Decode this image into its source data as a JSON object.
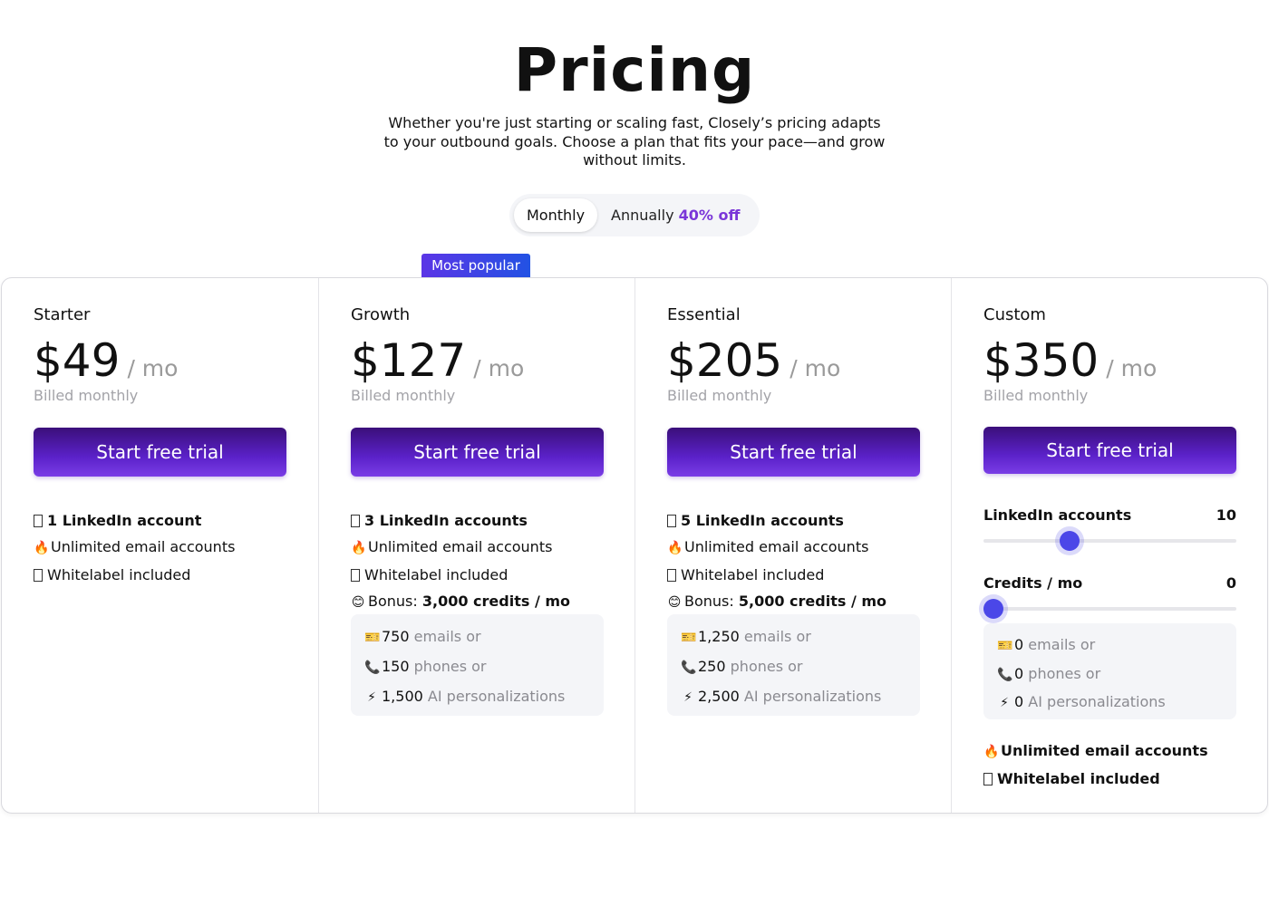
{
  "hero": {
    "title": "Pricing",
    "subtitle": "Whether you're just starting or scaling fast, Closely’s pricing adapts to your outbound goals. Choose a plan that fits your pace—and grow without limits."
  },
  "billing_toggle": {
    "monthly_label": "Monthly",
    "annual_label": "Annually",
    "annual_discount": "40% off",
    "selected": "Monthly"
  },
  "badge": {
    "label": "Most popular"
  },
  "plans": [
    {
      "name": "Starter",
      "price": "$49",
      "period": "/ mo",
      "billing": "Billed monthly",
      "cta": "Start free trial",
      "features": {
        "linkedin": "1 LinkedIn account",
        "email": "Unlimited email accounts",
        "whitelabel": "Whitelabel included"
      }
    },
    {
      "name": "Growth",
      "price": "$127",
      "period": "/ mo",
      "billing": "Billed monthly",
      "cta": "Start free trial",
      "features": {
        "linkedin": "3 LinkedIn accounts",
        "email": "Unlimited email accounts",
        "whitelabel": "Whitelabel included",
        "bonus_prefix": "Bonus:",
        "bonus_value": "3,000 credits / mo"
      },
      "credits": {
        "emails_value": "750",
        "emails_label": "emails or",
        "phones_value": "150",
        "phones_label": "phones or",
        "ai_value": "1,500",
        "ai_label": "AI personalizations"
      }
    },
    {
      "name": "Essential",
      "price": "$205",
      "period": "/ mo",
      "billing": "Billed monthly",
      "cta": "Start free trial",
      "features": {
        "linkedin": "5 LinkedIn accounts",
        "email": "Unlimited email accounts",
        "whitelabel": "Whitelabel included",
        "bonus_prefix": "Bonus:",
        "bonus_value": "5,000 credits / mo"
      },
      "credits": {
        "emails_value": "1,250",
        "emails_label": "emails or",
        "phones_value": "250",
        "phones_label": "phones or",
        "ai_value": "2,500",
        "ai_label": "AI personalizations"
      }
    },
    {
      "name": "Custom",
      "price": "$350",
      "period": "/ mo",
      "billing": "Billed monthly",
      "cta": "Start free trial",
      "sliders": {
        "linkedin_label": "LinkedIn accounts",
        "linkedin_value": "10",
        "linkedin_fraction": 0.34,
        "credits_label": "Credits / mo",
        "credits_value": "0",
        "credits_fraction": 0.0
      },
      "credits": {
        "emails_value": "0",
        "emails_label": "emails or",
        "phones_value": "0",
        "phones_label": "phones or",
        "ai_value": "0",
        "ai_label": "AI personalizations"
      },
      "features": {
        "email": "Unlimited email accounts",
        "whitelabel": "Whitelabel included"
      }
    }
  ],
  "icons": {
    "linkedin": "square-icon",
    "email": "fire-icon",
    "whitelabel": "square-icon",
    "bonus": "smile-icon",
    "emails": "ticket-icon",
    "phones": "phone-icon",
    "ai": "lightning-icon"
  },
  "colors": {
    "accent_purple": "#7a36d8",
    "cta_top": "#3a0f7a",
    "cta_bottom": "#7a3de6",
    "slider_thumb": "#4b47e8"
  }
}
